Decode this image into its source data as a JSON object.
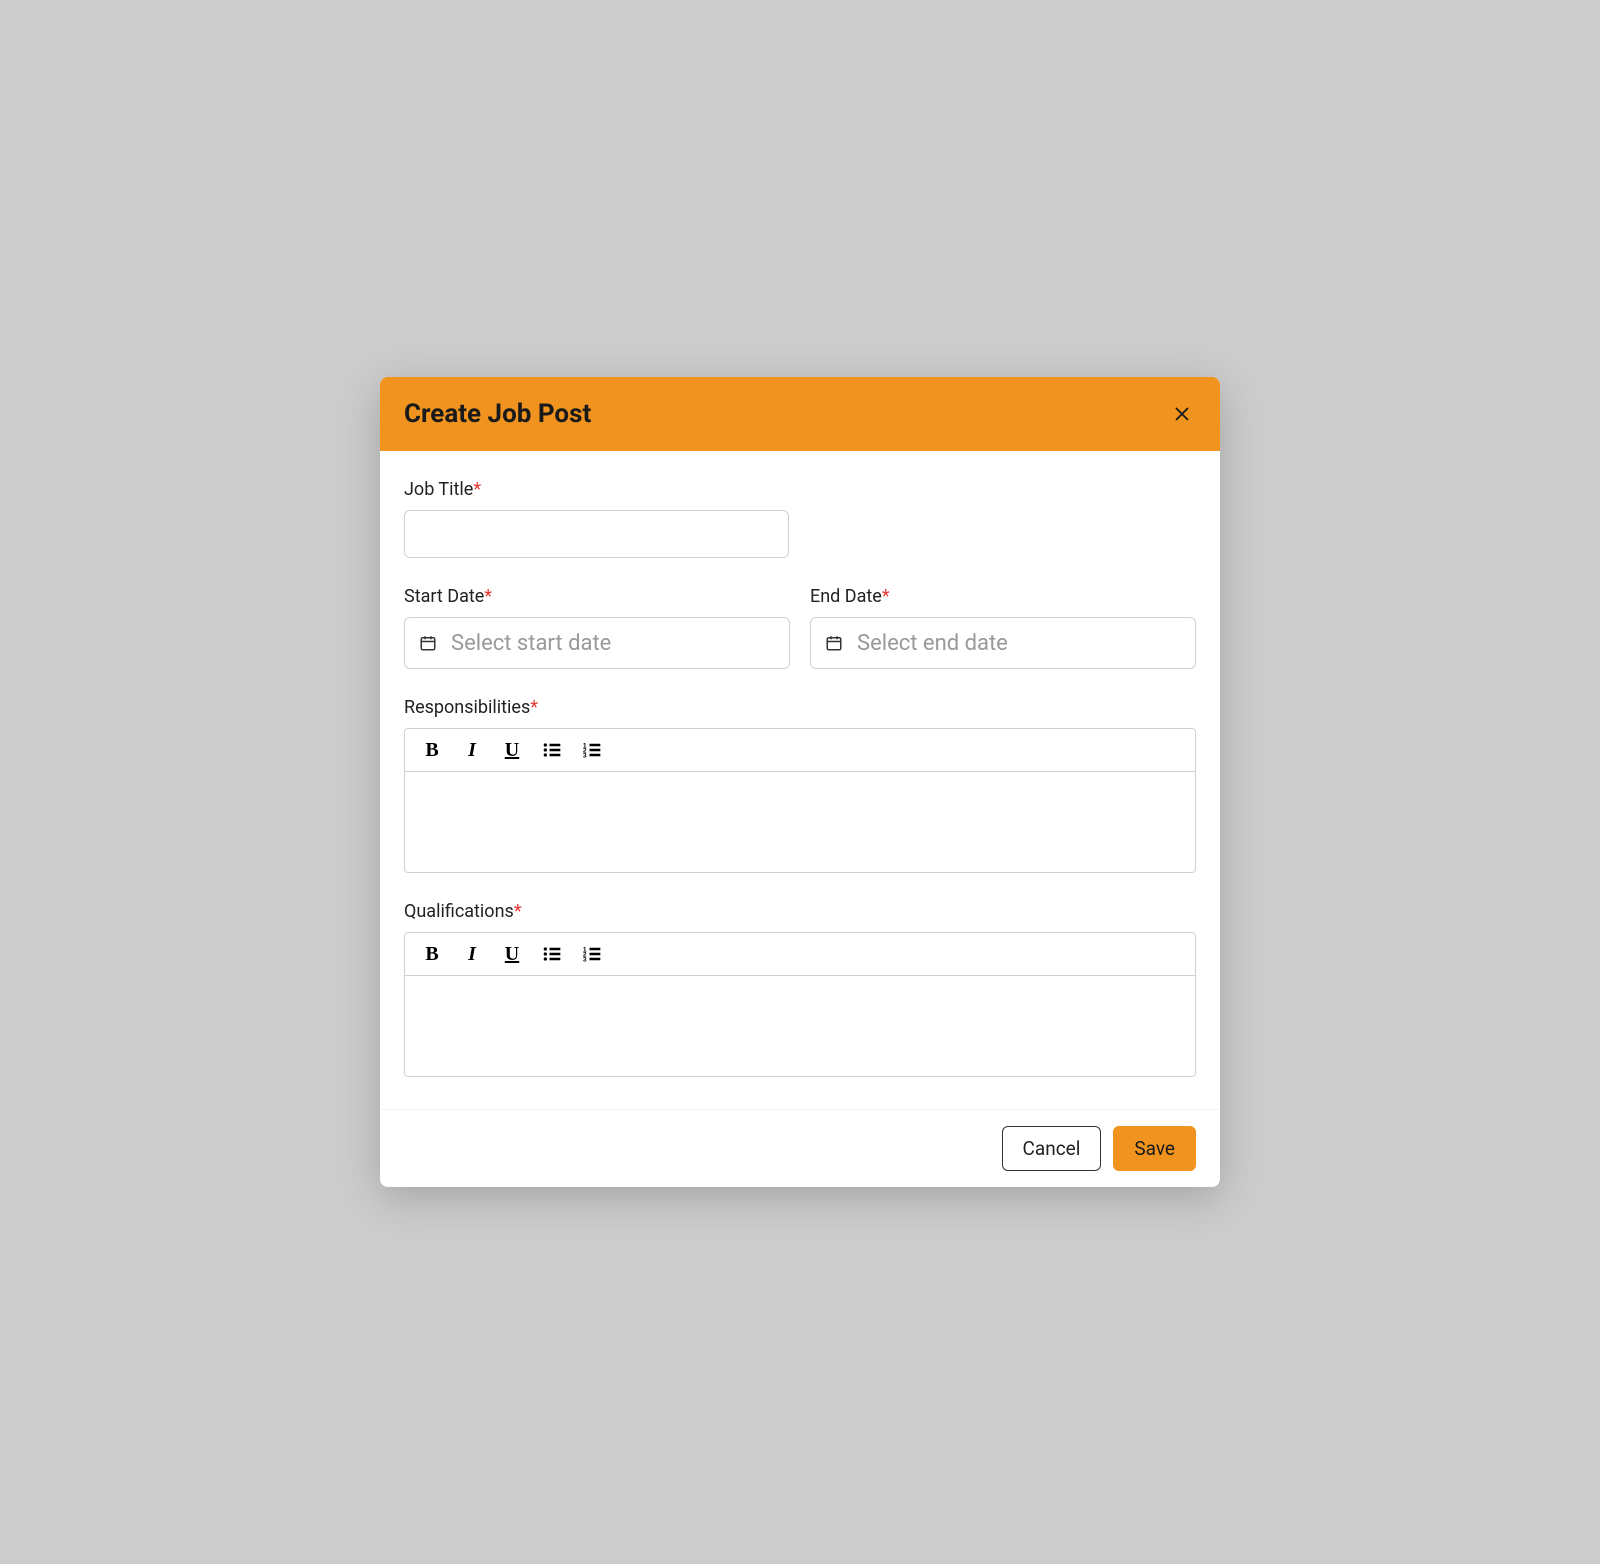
{
  "modal": {
    "title": "Create Job Post"
  },
  "fields": {
    "job_title": {
      "label": "Job Title",
      "value": ""
    },
    "start_date": {
      "label": "Start Date",
      "placeholder": "Select start date"
    },
    "end_date": {
      "label": "End Date",
      "placeholder": "Select end date"
    },
    "responsibilities": {
      "label": "Responsibilities"
    },
    "qualifications": {
      "label": "Qualifications"
    }
  },
  "buttons": {
    "cancel": "Cancel",
    "save": "Save"
  },
  "required_marker": "*"
}
